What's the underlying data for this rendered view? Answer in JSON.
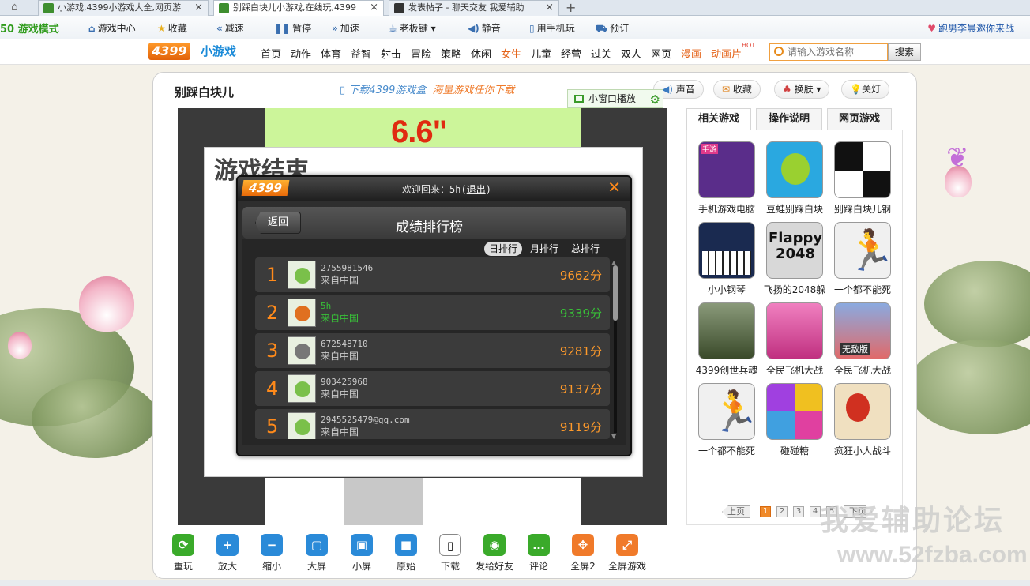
{
  "browser": {
    "tabs": [
      {
        "title": "小游戏,4399小游戏大全,网页游"
      },
      {
        "title": "别踩白块儿小游戏,在线玩,4399"
      },
      {
        "title": "发表帖子 - 聊天交友 我爱辅助"
      }
    ],
    "new_tab": "+"
  },
  "toolbar": {
    "mode": "50 游戏模式",
    "items": [
      "游戏中心",
      "收藏",
      "减速",
      "暂停",
      "加速",
      "老板键",
      "静音",
      "用手机玩",
      "预订"
    ],
    "promo": "跑男李晨邀你来战"
  },
  "sitenav": {
    "logo": "4399",
    "logo_suffix": "小游戏",
    "links": [
      "首页",
      "动作",
      "体育",
      "益智",
      "射击",
      "冒险",
      "策略",
      "休闲",
      "女生",
      "儿童",
      "经营",
      "过关",
      "双人",
      "网页",
      "漫画",
      "动画片"
    ],
    "hot_badge": "HOT",
    "search_placeholder": "请输入游戏名称",
    "search_button": "搜索"
  },
  "panel": {
    "title": "别踩白块儿",
    "download_banner": "下载4399游戏盒",
    "download_sub": "海量游戏任你下载",
    "buttons": {
      "sound": "声音",
      "favorite": "收藏",
      "skin": "换肤",
      "lights": "关灯"
    },
    "mini_play": "小窗口播放"
  },
  "game": {
    "timer": "6.6\"",
    "game_over": "游戏结束"
  },
  "leaderboard": {
    "logo": "4399",
    "welcome": "欢迎回来：5h(",
    "logout": "退出",
    "welcome_end": ")",
    "close": "✕",
    "back": "返回",
    "title": "成绩排行榜",
    "tabs": [
      "日排行",
      "月排行",
      "总排行"
    ],
    "active_tab": 0,
    "rows": [
      {
        "rank": "1",
        "name": "2755981546",
        "from": "来自中国",
        "score": "9662分",
        "me": false
      },
      {
        "rank": "2",
        "name": "5h",
        "from": "来自中国",
        "score": "9339分",
        "me": true
      },
      {
        "rank": "3",
        "name": "672548710",
        "from": "来自中国",
        "score": "9281分",
        "me": false
      },
      {
        "rank": "4",
        "name": "903425968",
        "from": "来自中国",
        "score": "9137分",
        "me": false
      },
      {
        "rank": "5",
        "name": "2945525479@qq.com",
        "from": "来自中国",
        "score": "9119分",
        "me": false
      }
    ]
  },
  "sidebar": {
    "tabs": [
      "相关游戏",
      "操作说明",
      "网页游戏"
    ],
    "games": [
      {
        "name": "手机游戏电脑",
        "color": "#5a2d8a",
        "badge": "手游"
      },
      {
        "name": "豆蛙别踩白块",
        "color": "#2aa8e0",
        "badge": ""
      },
      {
        "name": "别踩白块儿钢",
        "color": "#ffffff",
        "badge": ""
      },
      {
        "name": "小小钢琴",
        "color": "#1a2a50",
        "badge": ""
      },
      {
        "name": "飞扬的2048躲",
        "color": "#d8d8d8",
        "badge": "Flappy 2048"
      },
      {
        "name": "一个都不能死",
        "color": "#f0f0f0",
        "badge": ""
      },
      {
        "name": "4399创世兵魂",
        "color": "#4a5a3a",
        "badge": ""
      },
      {
        "name": "全民飞机大战",
        "color": "#e060a0",
        "badge": ""
      },
      {
        "name": "全民飞机大战",
        "color": "#6a8ad0",
        "badge": "无敌版"
      },
      {
        "name": "一个都不能死",
        "color": "#f0f0f0",
        "badge": ""
      },
      {
        "name": "碰碰糖",
        "color": "#8a40c0",
        "badge": ""
      },
      {
        "name": "疯狂小人战斗",
        "color": "#f0e0c0",
        "badge": ""
      }
    ],
    "pager": {
      "prev": "上页",
      "pages": [
        "1",
        "2",
        "3",
        "4",
        "5"
      ],
      "active": "1",
      "next": "下页"
    }
  },
  "bottom_toolbar": [
    {
      "label": "重玩",
      "icon": "replay-icon",
      "color": "#3aaa2a",
      "glyph": "⟳"
    },
    {
      "label": "放大",
      "icon": "zoom-in-icon",
      "color": "#2a8ad8",
      "glyph": "+"
    },
    {
      "label": "缩小",
      "icon": "zoom-out-icon",
      "color": "#2a8ad8",
      "glyph": "−"
    },
    {
      "label": "大屏",
      "icon": "big-screen-icon",
      "color": "#2a8ad8",
      "glyph": "▢"
    },
    {
      "label": "小屏",
      "icon": "small-screen-icon",
      "color": "#2a8ad8",
      "glyph": "▣"
    },
    {
      "label": "原始",
      "icon": "original-size-icon",
      "color": "#2a8ad8",
      "glyph": "■"
    },
    {
      "label": "下载",
      "icon": "phone-icon",
      "color": "#ffffff",
      "glyph": "▯"
    },
    {
      "label": "发给好友",
      "icon": "qq-icon",
      "color": "#3aaa2a",
      "glyph": "◉"
    },
    {
      "label": "评论",
      "icon": "comment-icon",
      "color": "#3aaa2a",
      "glyph": "…"
    },
    {
      "label": "全屏2",
      "icon": "fullscreen-2-icon",
      "color": "#f07a2a",
      "glyph": "✥"
    },
    {
      "label": "全屏游戏",
      "icon": "fullscreen-icon",
      "color": "#f07a2a",
      "glyph": "⤢"
    }
  ],
  "watermark": {
    "line1": "我爱辅助论坛",
    "line2": "www.52fzba.com"
  }
}
